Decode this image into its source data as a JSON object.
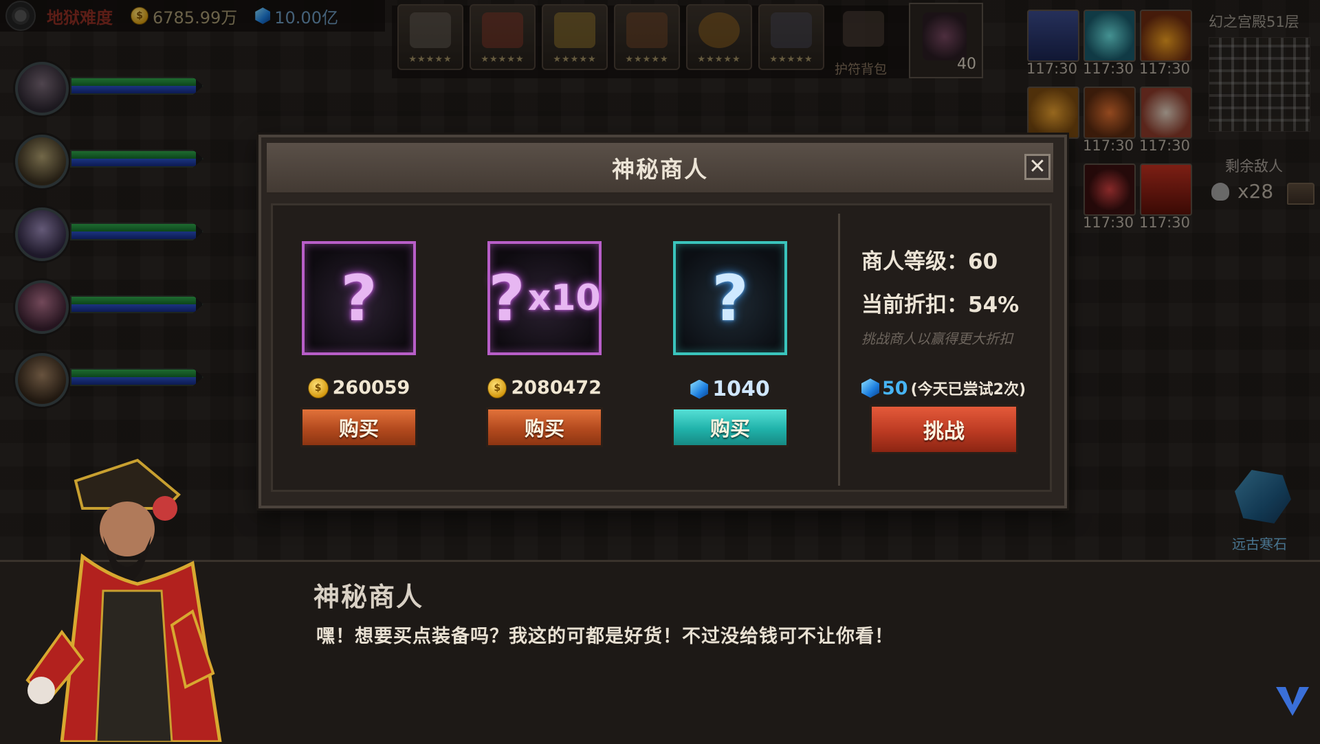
{
  "topbar": {
    "difficulty": "地狱难度",
    "gold": "6785.99万",
    "gems": "10.00亿"
  },
  "heroes": [
    {
      "hp": 0.95,
      "mp": 0.95
    },
    {
      "hp": 0.95,
      "mp": 0.95
    },
    {
      "hp": 0.95,
      "mp": 0.95
    },
    {
      "hp": 0.95,
      "mp": 0.95
    },
    {
      "hp": 0.95,
      "mp": 0.95
    }
  ],
  "equipment": {
    "stars": "★★★★★",
    "bag_label": "护符背包",
    "summon_count": "40"
  },
  "buffs": {
    "time": "117:30",
    "partial_time": "0"
  },
  "dungeon": {
    "floor": "幻之宫殿51层",
    "remaining_label": "剩余敌人",
    "remaining_count": "x28",
    "stone_label": "远古寒石"
  },
  "shop": {
    "title": "神秘商人",
    "items": [
      {
        "mark": "?",
        "multiplier": "",
        "price": "260059",
        "currency": "gold",
        "buy_label": "购买"
      },
      {
        "mark": "?",
        "multiplier": "x10",
        "price": "2080472",
        "currency": "gold",
        "buy_label": "购买"
      },
      {
        "mark": "?",
        "multiplier": "",
        "price": "1040",
        "currency": "gem",
        "buy_label": "购买"
      }
    ],
    "merchant_level": "商人等级：60",
    "discount": "当前折扣：54%",
    "hint": "挑战商人以赢得更大折扣",
    "challenge_cost": "50",
    "challenge_note": "(今天已尝试2次)",
    "challenge_label": "挑战"
  },
  "dialog": {
    "speaker": "神秘商人",
    "text": "嘿！想要买点装备吗？我这的可都是好货！不过没给钱可不让你看！"
  },
  "colors": {
    "purple_frame": "#b85ec8",
    "cyan_frame": "#3ac4bc",
    "orange_button": "#b34a1e",
    "teal_button": "#20b2aa",
    "challenge_button": "#bb3a22",
    "gem_blue": "#47b4f4"
  }
}
